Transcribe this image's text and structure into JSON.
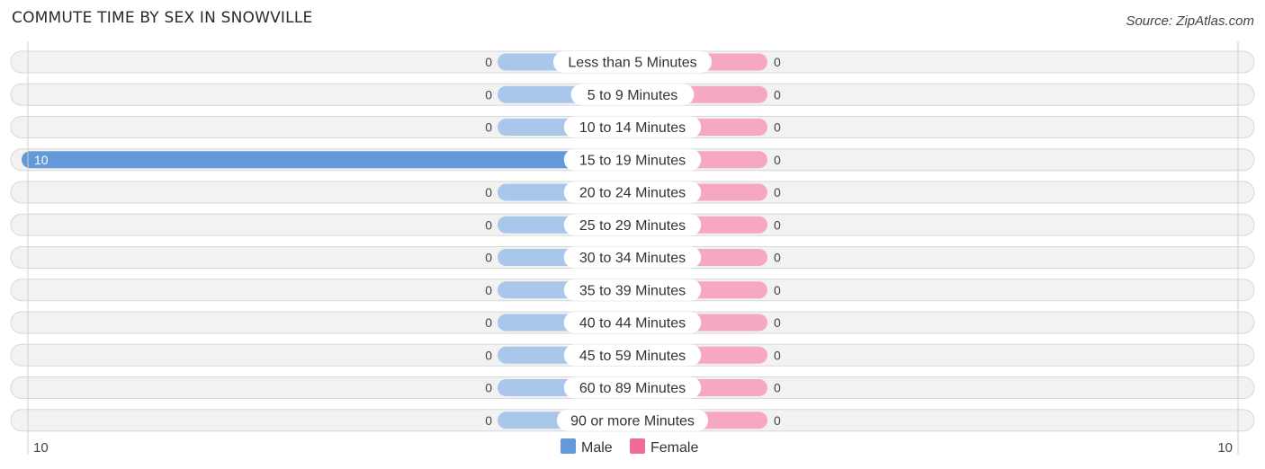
{
  "header": {
    "title": "COMMUTE TIME BY SEX IN SNOWVILLE",
    "source": "Source: ZipAtlas.com"
  },
  "colors": {
    "male_strong": "#6399d8",
    "male_light": "#a9c7ea",
    "female_strong": "#f06b96",
    "female_light": "#f6a8c0",
    "row_background": "#f2f2f2"
  },
  "chart_data": {
    "type": "bar",
    "orientation": "horizontal-diverging",
    "title": "COMMUTE TIME BY SEX IN SNOWVILLE",
    "categories": [
      "Less than 5 Minutes",
      "5 to 9 Minutes",
      "10 to 14 Minutes",
      "15 to 19 Minutes",
      "20 to 24 Minutes",
      "25 to 29 Minutes",
      "30 to 34 Minutes",
      "35 to 39 Minutes",
      "40 to 44 Minutes",
      "45 to 59 Minutes",
      "60 to 89 Minutes",
      "90 or more Minutes"
    ],
    "series": [
      {
        "name": "Male",
        "side": "left",
        "values": [
          0,
          0,
          0,
          10,
          0,
          0,
          0,
          0,
          0,
          0,
          0,
          0
        ]
      },
      {
        "name": "Female",
        "side": "right",
        "values": [
          0,
          0,
          0,
          0,
          0,
          0,
          0,
          0,
          0,
          0,
          0,
          0
        ]
      }
    ],
    "axis": {
      "min_label": "10",
      "max_label": "10",
      "range": [
        -10,
        10
      ]
    },
    "legend": {
      "position": "bottom-center",
      "entries": [
        "Male",
        "Female"
      ]
    },
    "grid": false
  }
}
